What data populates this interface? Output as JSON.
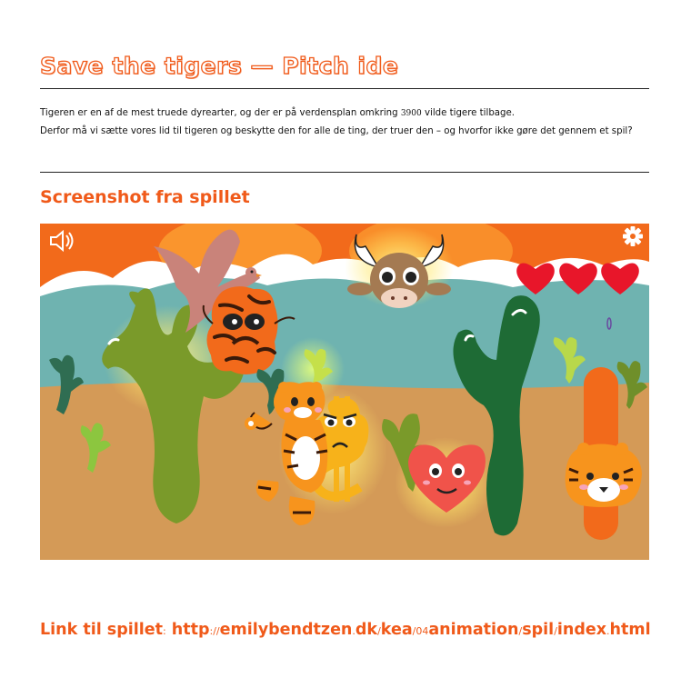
{
  "page": {
    "title": "Save the tigers — Pitch ide",
    "intro": {
      "line1_before": "Tigeren er en af de mest truede dyrearter, og der er på verdensplan omkring ",
      "line1_number": "3900",
      "line1_after": " vilde tigere tilbage.",
      "line2": "Derfor må vi sætte vores lid til tigeren og beskytte den for alle de ting, der truer den – og hvorfor ikke gøre det gennem et spil?"
    },
    "screenshot_heading": "Screenshot fra spillet",
    "link": {
      "label": "Link til spillet",
      "colon": ":",
      "parts": [
        "http",
        "://",
        "emilybendtzen",
        ".",
        "dk",
        "/",
        "kea",
        "/04",
        "animation",
        "/",
        "spil",
        "/",
        "index",
        ".",
        "html"
      ]
    }
  },
  "game": {
    "icons": [
      "speaker-icon",
      "gear-icon"
    ],
    "lives": 3,
    "colors": {
      "sky": "#f26a1b",
      "mountains": "#ffffff",
      "water": "#6fb3b0",
      "ground": "#d49a57",
      "accent": "#f05a1a"
    }
  }
}
